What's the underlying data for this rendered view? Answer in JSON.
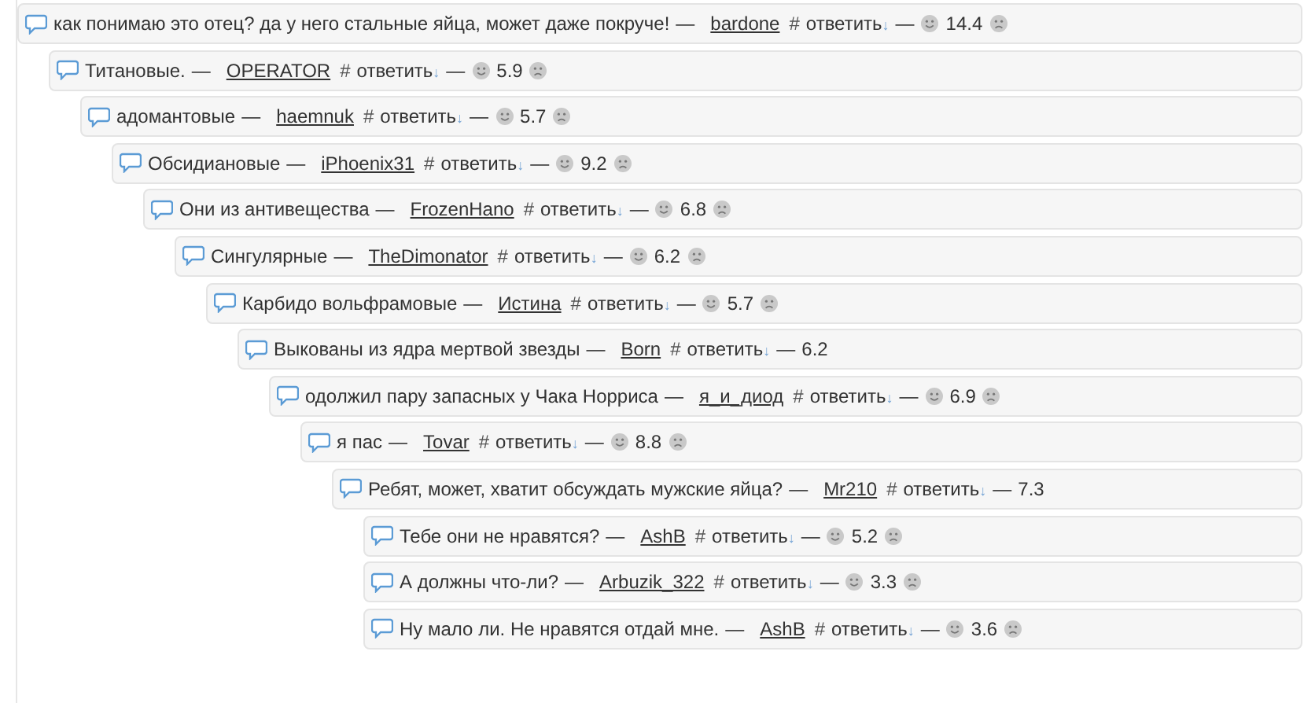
{
  "comments": [
    {
      "text": "как понимаю это отец? да у него стальные яйца, может даже покруче!",
      "sep": "—",
      "author": "bardone",
      "anchor": "#",
      "reply": "ответить",
      "reply_arrow": "↓",
      "sep2": "—",
      "rating": "14.4",
      "votable": true,
      "children": [
        {
          "text": "Титановые.",
          "sep": "—",
          "author": "OPERATOR",
          "anchor": "#",
          "reply": "ответить",
          "reply_arrow": "↓",
          "sep2": "—",
          "rating": "5.9",
          "votable": true,
          "children": [
            {
              "text": "адомантовые",
              "sep": "—",
              "author": "haemnuk",
              "anchor": "#",
              "reply": "ответить",
              "reply_arrow": "↓",
              "sep2": "—",
              "rating": "5.7",
              "votable": true,
              "children": [
                {
                  "text": "Обсидиановые",
                  "sep": "—",
                  "author": "iPhoenix31",
                  "anchor": "#",
                  "reply": "ответить",
                  "reply_arrow": "↓",
                  "sep2": "—",
                  "rating": "9.2",
                  "votable": true,
                  "children": [
                    {
                      "text": "Они из антивещества",
                      "sep": "—",
                      "author": "FrozenHano",
                      "anchor": "#",
                      "reply": "ответить",
                      "reply_arrow": "↓",
                      "sep2": "—",
                      "rating": "6.8",
                      "votable": true,
                      "children": [
                        {
                          "text": "Сингулярные",
                          "sep": "—",
                          "author": "TheDimonator",
                          "anchor": "#",
                          "reply": "ответить",
                          "reply_arrow": "↓",
                          "sep2": "—",
                          "rating": "6.2",
                          "votable": true,
                          "children": [
                            {
                              "text": "Карбидо вольфрамовые",
                              "sep": "—",
                              "author": "Истина",
                              "anchor": "#",
                              "reply": "ответить",
                              "reply_arrow": "↓",
                              "sep2": "—",
                              "rating": "5.7",
                              "votable": true,
                              "children": [
                                {
                                  "text": "Выкованы из ядра мертвой звезды",
                                  "sep": "—",
                                  "author": "Born",
                                  "anchor": "#",
                                  "reply": "ответить",
                                  "reply_arrow": "↓",
                                  "sep2": "—",
                                  "rating": "6.2",
                                  "votable": false,
                                  "children": [
                                    {
                                      "text": "одолжил пару запасных у Чака Норриса",
                                      "sep": "—",
                                      "author": "я_и_диод",
                                      "anchor": "#",
                                      "reply": "ответить",
                                      "reply_arrow": "↓",
                                      "sep2": "—",
                                      "rating": "6.9",
                                      "votable": true,
                                      "children": [
                                        {
                                          "text": "я пас",
                                          "sep": "—",
                                          "author": "Tovar",
                                          "anchor": "#",
                                          "reply": "ответить",
                                          "reply_arrow": "↓",
                                          "sep2": "—",
                                          "rating": "8.8",
                                          "votable": true,
                                          "children": [
                                            {
                                              "text": "Ребят, может, хватит обсуждать мужские яйца?",
                                              "sep": "—",
                                              "author": "Mr210",
                                              "anchor": "#",
                                              "reply": "ответить",
                                              "reply_arrow": "↓",
                                              "sep2": "—",
                                              "rating": "7.3",
                                              "votable": false,
                                              "children": [
                                                {
                                                  "text": "Тебе они не нравятся?",
                                                  "sep": "—",
                                                  "author": "AshB",
                                                  "anchor": "#",
                                                  "reply": "ответить",
                                                  "reply_arrow": "↓",
                                                  "sep2": "—",
                                                  "rating": "5.2",
                                                  "votable": true
                                                },
                                                {
                                                  "text": "А должны что-ли?",
                                                  "sep": "—",
                                                  "author": "Arbuzik_322",
                                                  "anchor": "#",
                                                  "reply": "ответить",
                                                  "reply_arrow": "↓",
                                                  "sep2": "—",
                                                  "rating": "3.3",
                                                  "votable": true
                                                },
                                                {
                                                  "text": "Ну мало ли. Не нравятся отдай мне.",
                                                  "sep": "—",
                                                  "author": "AshB",
                                                  "anchor": "#",
                                                  "reply": "ответить",
                                                  "reply_arrow": "↓",
                                                  "sep2": "—",
                                                  "rating": "3.6",
                                                  "votable": true
                                                }
                                              ]
                                            }
                                          ]
                                        }
                                      ]
                                    }
                                  ]
                                }
                              ]
                            }
                          ]
                        }
                      ]
                    }
                  ]
                }
              ]
            }
          ]
        }
      ]
    }
  ]
}
